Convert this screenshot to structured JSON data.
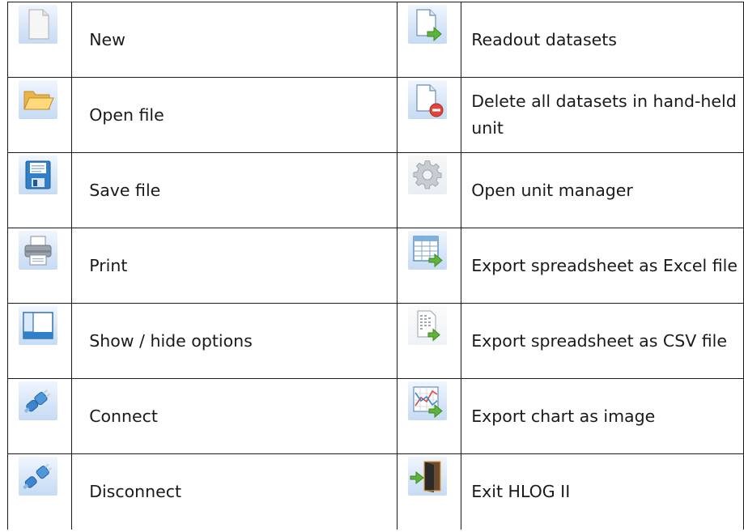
{
  "rows": [
    {
      "left": {
        "icon": "new-document-icon",
        "label": "New"
      },
      "right": {
        "icon": "readout-datasets-icon",
        "label": "Readout datasets"
      }
    },
    {
      "left": {
        "icon": "open-folder-icon",
        "label": "Open file"
      },
      "right": {
        "icon": "delete-datasets-icon",
        "label": "Delete all datasets in hand-held unit"
      }
    },
    {
      "left": {
        "icon": "floppy-disk-icon",
        "label": "Save file"
      },
      "right": {
        "icon": "gear-icon",
        "label": "Open unit manager"
      }
    },
    {
      "left": {
        "icon": "printer-icon",
        "label": "Print"
      },
      "right": {
        "icon": "export-excel-icon",
        "label": "Export spreadsheet as Excel file"
      }
    },
    {
      "left": {
        "icon": "options-panel-icon",
        "label": "Show / hide options"
      },
      "right": {
        "icon": "export-csv-icon",
        "label": "Export spreadsheet as CSV file"
      }
    },
    {
      "left": {
        "icon": "connect-plug-icon",
        "label": "Connect"
      },
      "right": {
        "icon": "export-chart-icon",
        "label": "Export chart as image"
      }
    },
    {
      "left": {
        "icon": "disconnect-plug-icon",
        "label": "Disconnect"
      },
      "right": {
        "icon": "exit-door-icon",
        "label": "Exit HLOG II"
      }
    }
  ]
}
